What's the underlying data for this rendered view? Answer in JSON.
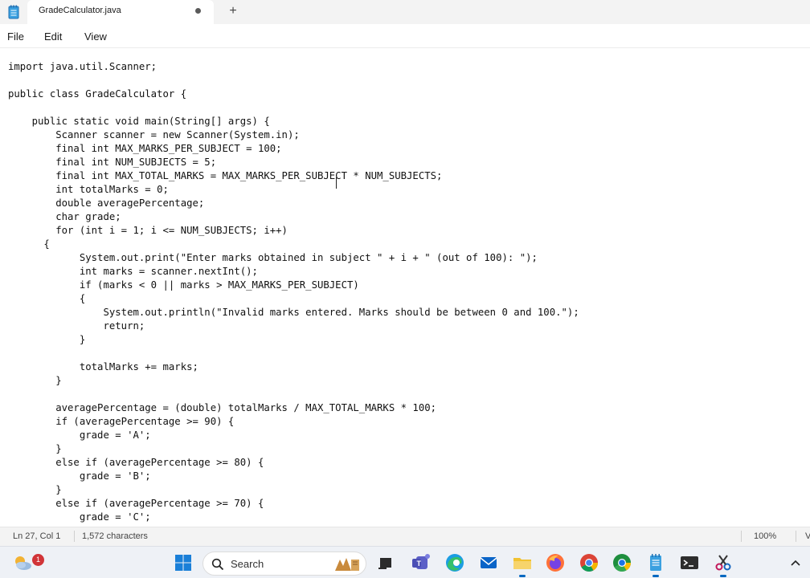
{
  "window": {
    "tab_title": "GradeCalculator.java",
    "new_tab_label": "+"
  },
  "menu": {
    "items": [
      {
        "label": "File"
      },
      {
        "label": "Edit"
      },
      {
        "label": "View"
      }
    ]
  },
  "editor": {
    "lines": [
      "import java.util.Scanner;",
      "",
      "public class GradeCalculator {",
      "",
      "    public static void main(String[] args) {",
      "        Scanner scanner = new Scanner(System.in);",
      "        final int MAX_MARKS_PER_SUBJECT = 100;",
      "        final int NUM_SUBJECTS = 5;",
      "        final int MAX_TOTAL_MARKS = MAX_MARKS_PER_SUBJECT * NUM_SUBJECTS;",
      "        int totalMarks = 0;",
      "        double averagePercentage;",
      "        char grade;",
      "        for (int i = 1; i <= NUM_SUBJECTS; i++)",
      "      {",
      "            System.out.print(\"Enter marks obtained in subject \" + i + \" (out of 100): \");",
      "            int marks = scanner.nextInt();",
      "            if (marks < 0 || marks > MAX_MARKS_PER_SUBJECT)",
      "            {",
      "                System.out.println(\"Invalid marks entered. Marks should be between 0 and 100.\");",
      "                return;",
      "            }",
      "",
      "            totalMarks += marks;",
      "        }",
      "",
      "        averagePercentage = (double) totalMarks / MAX_TOTAL_MARKS * 100;",
      "        if (averagePercentage >= 90) {",
      "            grade = 'A';",
      "        }",
      "        else if (averagePercentage >= 80) {",
      "            grade = 'B';",
      "        }",
      "        else if (averagePercentage >= 70) {",
      "            grade = 'C';"
    ]
  },
  "status": {
    "position": "Ln 27, Col 1",
    "characters": "1,572 characters",
    "zoom": "100%",
    "encoding_partial": "V"
  },
  "taskbar": {
    "search_label": "Search",
    "notification_count": "1",
    "icons": [
      "weather-icon",
      "start-icon",
      "search-icon",
      "widgets-icon",
      "file-explorer-task-icon",
      "teams-icon",
      "edge-icon",
      "mail-icon",
      "folder-icon",
      "firefox-icon",
      "chrome-icon",
      "chrome-dev-icon",
      "notepad-icon",
      "terminal-icon",
      "snipping-tool-icon",
      "tray-chevron-icon"
    ]
  }
}
